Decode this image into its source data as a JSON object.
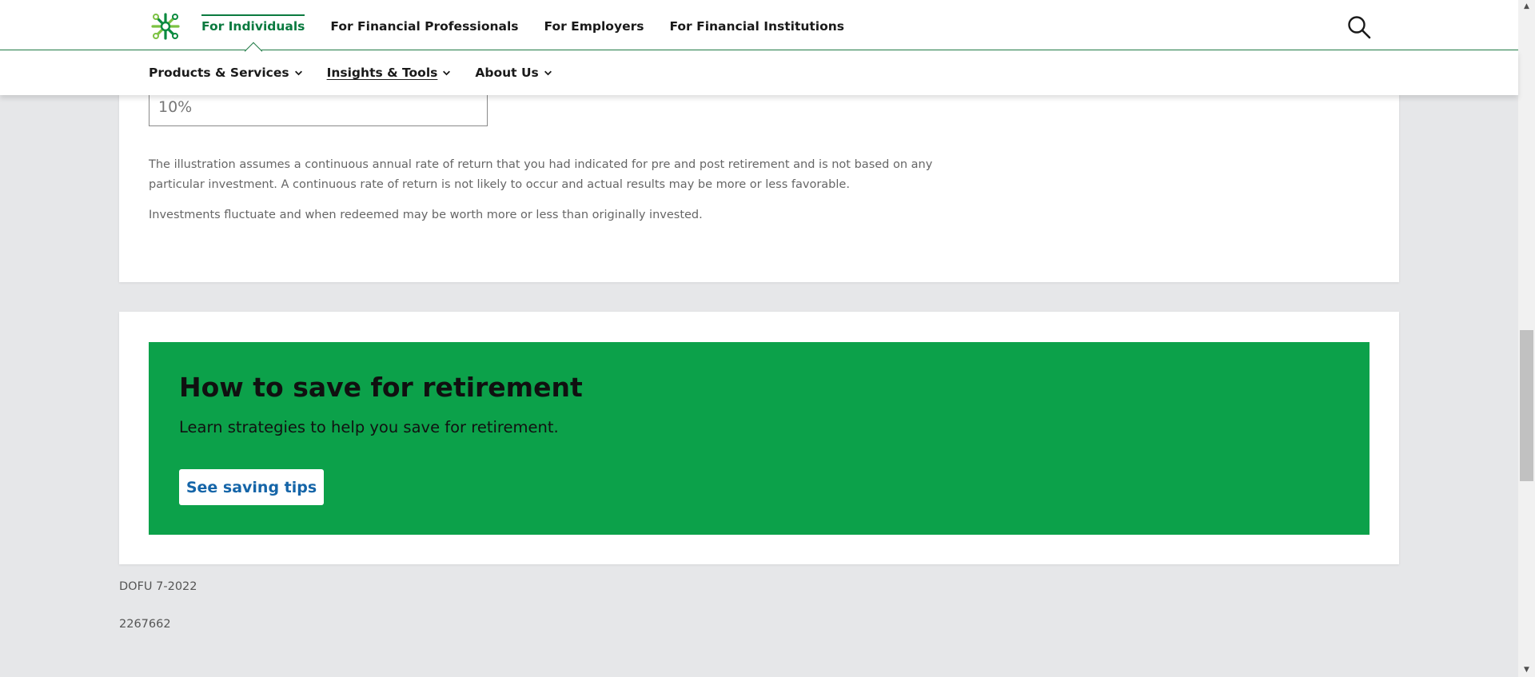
{
  "header": {
    "logo_icon": "brand-logo-icon",
    "audience_tabs": [
      {
        "label": "For Individuals",
        "active": true
      },
      {
        "label": "For Financial Professionals",
        "active": false
      },
      {
        "label": "For Employers",
        "active": false
      },
      {
        "label": "For Financial Institutions",
        "active": false
      }
    ],
    "search_icon": "search-icon"
  },
  "subnav": {
    "items": [
      {
        "label": "Products & Services",
        "icon": "chevron-down-icon"
      },
      {
        "label": "Insights & Tools",
        "icon": "chevron-down-icon"
      },
      {
        "label": "About Us",
        "icon": "chevron-down-icon"
      }
    ]
  },
  "calculator": {
    "rate_value": "10%"
  },
  "disclaimers": [
    "The illustration assumes a continuous annual rate of return that you had indicated for pre and post retirement and is not based on any particular investment. A continuous rate of return is not likely to occur and actual results may be more or less favorable.",
    "Investments fluctuate and when redeemed may be worth more or less than originally invested."
  ],
  "cta": {
    "title": "How to save for retirement",
    "text": "Learn strategies to help you save for retirement.",
    "button_label": "See saving tips"
  },
  "footer": {
    "codes": [
      "DOFU 7-2022",
      "2267662"
    ]
  },
  "colors": {
    "brand_green": "#0ca14a",
    "nav_active_green": "#0a7a3f",
    "button_text_blue": "#1565a8",
    "page_background": "#e6e7e9"
  }
}
